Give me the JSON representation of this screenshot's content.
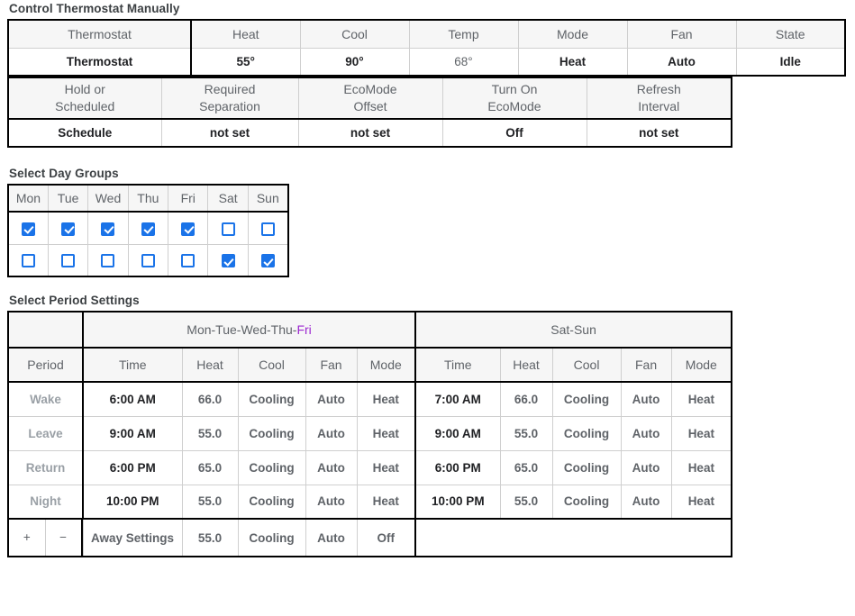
{
  "sections": {
    "control_label": "Control Thermostat Manually",
    "day_groups_label": "Select Day Groups",
    "period_settings_label": "Select Period Settings"
  },
  "colors": {
    "red": "#ff0000",
    "blue": "#1414ff",
    "green": "#008a00",
    "cooling_green": "#127c12",
    "purple": "#9c27d0",
    "violet": "#9614ff",
    "magenta": "#aa00c7",
    "gray": "#9aa0a6",
    "checkbox_blue": "#1a73e8",
    "plus_green": "#0a8f2e",
    "minus_red": "#e8443a"
  },
  "thermostat_table": {
    "headers": [
      "Thermostat",
      "Heat",
      "Cool",
      "Temp",
      "Mode",
      "Fan",
      "State"
    ],
    "row": {
      "name": "Thermostat",
      "heat": "55°",
      "cool": "90°",
      "temp": "68°",
      "mode": "Heat",
      "fan": "Auto",
      "state": "Idle"
    }
  },
  "settings_table": {
    "headers": [
      "Hold or Scheduled",
      "Required Separation",
      "EcoMode Offset",
      "Turn On EcoMode",
      "Refresh Interval"
    ],
    "headers_lines": [
      [
        "Hold or",
        "Scheduled"
      ],
      [
        "Required",
        "Separation"
      ],
      [
        "EcoMode",
        "Offset"
      ],
      [
        "Turn On",
        "EcoMode"
      ],
      [
        "Refresh",
        "Interval"
      ]
    ],
    "row": {
      "hold_or_scheduled": "Schedule",
      "required_separation": "not set",
      "ecomode_offset": "not set",
      "turn_on_ecomode": "Off",
      "refresh_interval": "not set"
    }
  },
  "day_groups": {
    "days": [
      "Mon",
      "Tue",
      "Wed",
      "Thu",
      "Fri",
      "Sat",
      "Sun"
    ],
    "highlighted_day": "Fri",
    "rows": [
      {
        "name": "group-1",
        "checked": [
          true,
          true,
          true,
          true,
          true,
          false,
          false
        ]
      },
      {
        "name": "group-2",
        "checked": [
          false,
          false,
          false,
          false,
          false,
          true,
          true
        ]
      }
    ]
  },
  "period_settings": {
    "group_headers": {
      "left_prefix": "Mon-Tue-Wed-Thu-",
      "left_highlight": "Fri",
      "left_full": "Mon-Tue-Wed-Thu-Fri",
      "right": "Sat-Sun"
    },
    "column_headers": {
      "period": "Period",
      "left": [
        "Time",
        "Heat",
        "Cool",
        "Fan",
        "Mode"
      ],
      "right": [
        "Time",
        "Heat",
        "Cool",
        "Fan",
        "Mode"
      ]
    },
    "rows": [
      {
        "period": "Wake",
        "period_color": "gray",
        "left": {
          "time": "6:00 AM",
          "heat": "66.0",
          "cool": "Cooling",
          "fan": "Auto",
          "mode": "Heat"
        },
        "right": {
          "time": "7:00 AM",
          "heat": "66.0",
          "cool": "Cooling",
          "fan": "Auto",
          "mode": "Heat"
        }
      },
      {
        "period": "Leave",
        "period_color": "violet",
        "left": {
          "time": "9:00 AM",
          "heat": "55.0",
          "cool": "Cooling",
          "fan": "Auto",
          "mode": "Heat"
        },
        "right": {
          "time": "9:00 AM",
          "heat": "55.0",
          "cool": "Cooling",
          "fan": "Auto",
          "mode": "Heat"
        }
      },
      {
        "period": "Return",
        "period_color": "gray",
        "left": {
          "time": "6:00 PM",
          "heat": "65.0",
          "cool": "Cooling",
          "fan": "Auto",
          "mode": "Heat"
        },
        "right": {
          "time": "6:00 PM",
          "heat": "65.0",
          "cool": "Cooling",
          "fan": "Auto",
          "mode": "Heat"
        }
      },
      {
        "period": "Night",
        "period_color": "gray",
        "left": {
          "time": "10:00 PM",
          "heat": "55.0",
          "cool": "Cooling",
          "fan": "Auto",
          "mode": "Heat"
        },
        "right": {
          "time": "10:00 PM",
          "heat": "55.0",
          "cool": "Cooling",
          "fan": "Auto",
          "mode": "Heat"
        }
      }
    ],
    "away_row": {
      "add_label": "+",
      "remove_label": "−",
      "label": "Away Settings",
      "heat": "55.0",
      "cool": "Cooling",
      "fan": "Auto",
      "mode": "Off"
    }
  }
}
